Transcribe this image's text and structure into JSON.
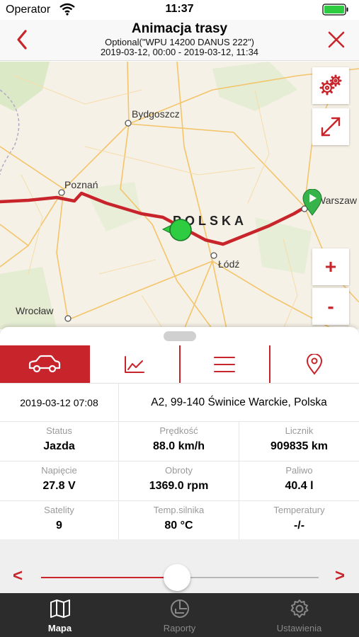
{
  "status_bar": {
    "carrier": "Operator",
    "time": "11:37"
  },
  "header": {
    "title": "Animacja trasy",
    "subtitle_line1": "Optional(\"WPU 14200 DANUS 222\")",
    "subtitle_line2": "2019-03-12, 00:00 - 2019-03-12, 11:34"
  },
  "map": {
    "cities": {
      "bydgoszcz": "Bydgoszcz",
      "poznan": "Poznań",
      "lodz": "Łódź",
      "wroclaw": "Wrocław",
      "warszawa": "Warszaw"
    },
    "country": "POLSKA",
    "zoom_in": "+",
    "zoom_out": "-"
  },
  "tabs": [
    "car-icon",
    "chart-icon",
    "list-icon",
    "location-pin-icon"
  ],
  "info": {
    "date": "2019-03-12 07:08",
    "address": "A2, 99-140 Świnice Warckie, Polska"
  },
  "stats": [
    {
      "label": "Status",
      "value": "Jazda"
    },
    {
      "label": "Prędkość",
      "value": "88.0 km/h"
    },
    {
      "label": "Licznik",
      "value": "909835 km"
    },
    {
      "label": "Napięcie",
      "value": "27.8 V"
    },
    {
      "label": "Obroty",
      "value": "1369.0 rpm"
    },
    {
      "label": "Paliwo",
      "value": "40.4 l"
    },
    {
      "label": "Satelity",
      "value": "9"
    },
    {
      "label": "Temp.silnika",
      "value": "80 °C"
    },
    {
      "label": "Temperatury",
      "value": "-/-"
    }
  ],
  "slider": {
    "prev": "<",
    "next": ">",
    "progress": 0.49
  },
  "tab_bar": {
    "map": "Mapa",
    "reports": "Raporty",
    "settings": "Ustawienia"
  },
  "colors": {
    "accent": "#c8242b",
    "route": "#c8242b",
    "current_position": "#2ecc40"
  }
}
